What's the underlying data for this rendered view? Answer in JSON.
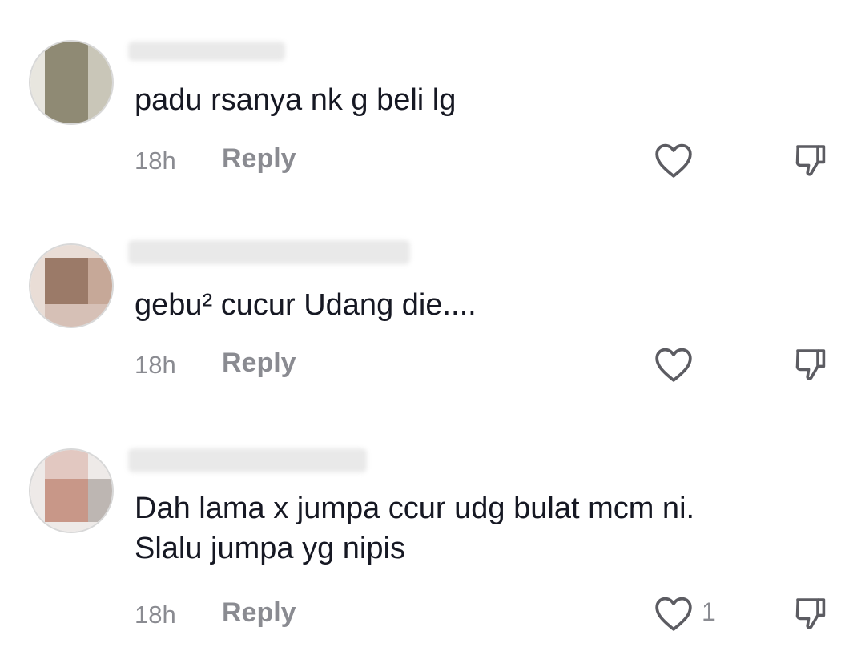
{
  "comments": [
    {
      "text": "padu rsanya nk g beli lg",
      "time": "18h",
      "reply_label": "Reply",
      "likes": "",
      "avatar_colors": [
        "#8f8a74",
        "#c9c6b8",
        "#e8e6df"
      ]
    },
    {
      "text": "gebu² cucur Udang die....",
      "time": "18h",
      "reply_label": "Reply",
      "likes": "",
      "avatar_colors": [
        "#9b7a68",
        "#c6a898",
        "#e9ddd6"
      ]
    },
    {
      "text": "Dah lama x jumpa ccur udg bulat mcm ni.\nSlalu jumpa yg nipis",
      "time": "18h",
      "reply_label": "Reply",
      "likes": "1",
      "avatar_colors": [
        "#c89788",
        "#e2c8c1",
        "#bdb6b2"
      ]
    }
  ],
  "icons": {
    "like": "heart-outline-icon",
    "dislike": "thumbs-down-outline-icon"
  },
  "colors": {
    "text": "#161823",
    "muted": "#8a8b91",
    "icon": "#5c5c62"
  }
}
